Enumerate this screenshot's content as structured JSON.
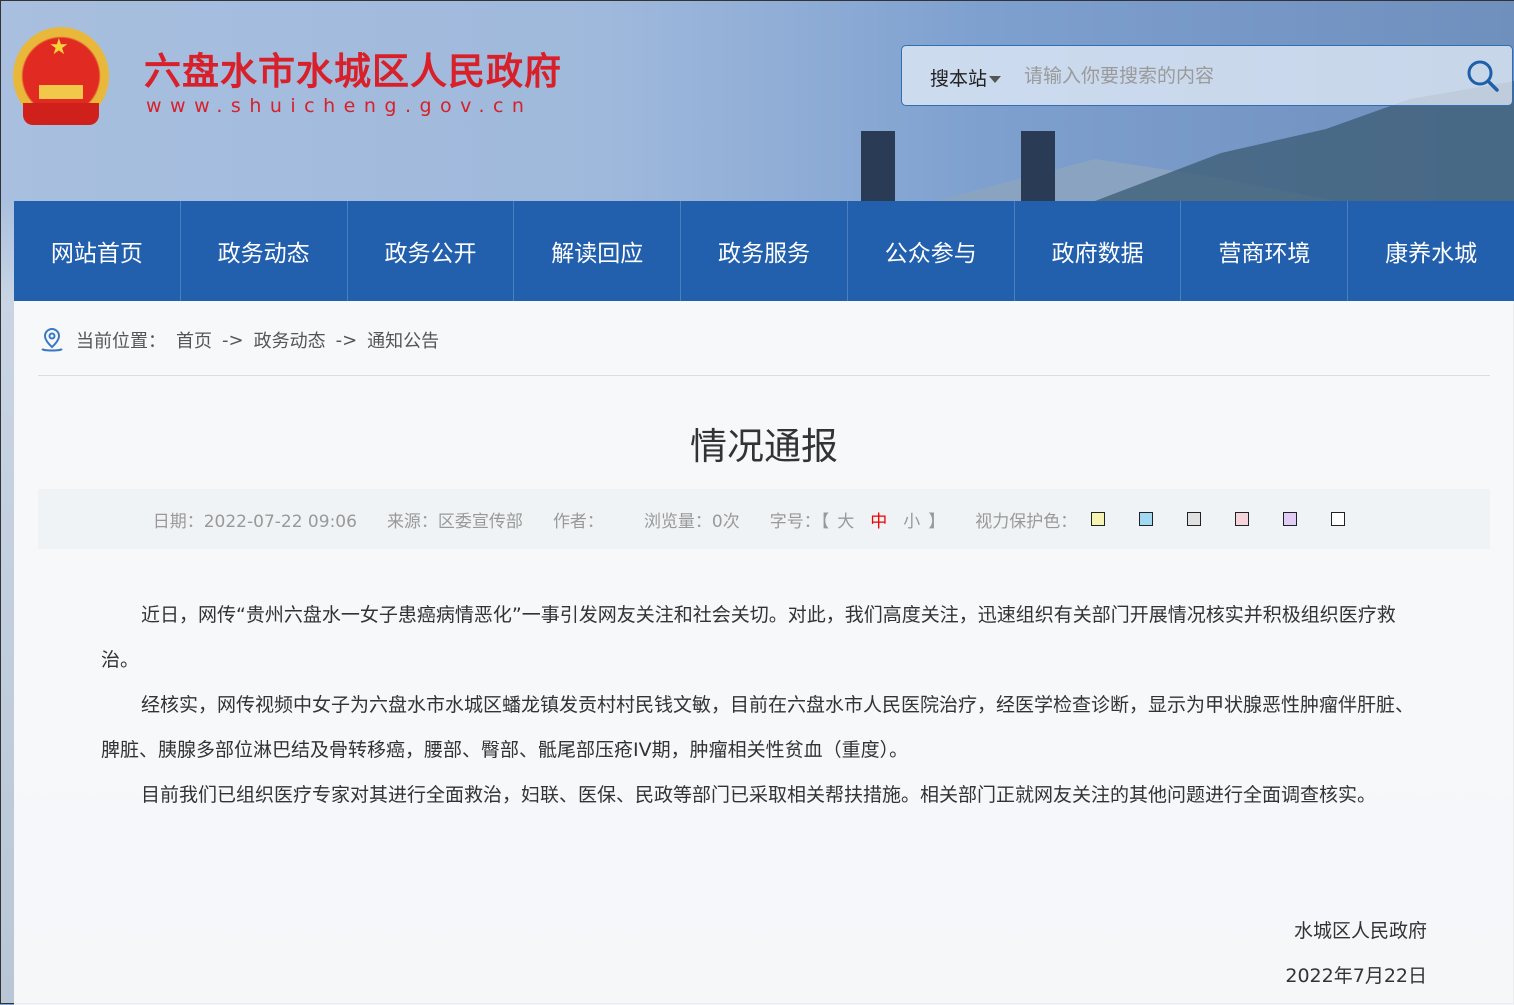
{
  "header": {
    "site_title": "六盘水市水城区人民政府",
    "site_url": "www.shuicheng.gov.cn"
  },
  "search": {
    "scope": "搜本站",
    "placeholder": "请输入你要搜索的内容"
  },
  "nav": [
    "网站首页",
    "政务动态",
    "政务公开",
    "解读回应",
    "政务服务",
    "公众参与",
    "政府数据",
    "营商环境",
    "康养水城"
  ],
  "breadcrumb": {
    "label": "当前位置：",
    "items": [
      "首页",
      "政务动态",
      "通知公告"
    ],
    "sep": "->"
  },
  "article": {
    "title": "情况通报",
    "meta": {
      "date": "日期：2022-07-22 09:06",
      "source": "来源：区委宣传部",
      "author": "作者：",
      "views": "浏览量：0次",
      "font_label": "字号：",
      "font_open": "【",
      "font_large": "大",
      "font_medium": "中",
      "font_small": "小",
      "font_close": "】",
      "eye_label": "视力保护色："
    },
    "eye_colors": [
      "#f7f3b0",
      "#a3d8f2",
      "#e0e0e0",
      "#f7d4dc",
      "#e0ccf5",
      "#ffffff"
    ],
    "paragraphs": [
      "近日，网传“贵州六盘水一女子患癌病情恶化”一事引发网友关注和社会关切。对此，我们高度关注，迅速组织有关部门开展情况核实并积极组织医疗救治。",
      "经核实，网传视频中女子为六盘水市水城区蟠龙镇发贡村村民钱文敏，目前在六盘水市人民医院治疗，经医学检查诊断，显示为甲状腺恶性肿瘤伴肝脏、脾脏、胰腺多部位淋巴结及骨转移癌，腰部、臀部、骶尾部压疮IV期，肿瘤相关性贫血（重度）。",
      "目前我们已组织医疗专家对其进行全面救治，妇联、医保、民政等部门已采取相关帮扶措施。相关部门正就网友关注的其他问题进行全面调查核实。"
    ],
    "signature": "水城区人民政府",
    "sign_date": "2022年7月22日"
  },
  "colors": {
    "nav": "#2260ad",
    "title_red": "#d8202a"
  }
}
